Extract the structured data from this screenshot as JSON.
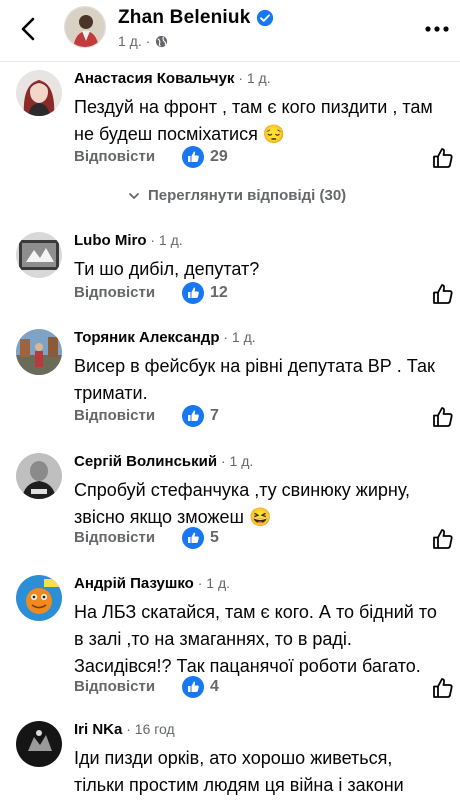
{
  "header": {
    "name": "Zhan  Beleniuk",
    "meta": "1 д. ·"
  },
  "comments": [
    {
      "author": "Анастасия Ковальчук",
      "time": " · 1 д.",
      "text": "Пездуй на фронт , там є кого пиздити , там не будеш посміхатися 😔",
      "reply_label": "Відповісти",
      "likes": "29"
    },
    {
      "author": "Lubo Miro",
      "time": " · 1 д.",
      "text": "Ти шо дибіл, депутат?",
      "reply_label": "Відповісти",
      "likes": "12"
    },
    {
      "author": "Торяник Александр",
      "time": " · 1 д.",
      "text": "Висер в фейсбук на рівні  депутата ВР . Так тримати.",
      "reply_label": "Відповісти",
      "likes": "7"
    },
    {
      "author": "Сергій Волинський",
      "time": " · 1 д.",
      "text": "Спробуй стефанчука ,ту свинюку жирну, звісно якщо зможеш 😆",
      "reply_label": "Відповісти",
      "likes": "5"
    },
    {
      "author": "Андрій Пазушко",
      "time": " · 1 д.",
      "text": "На ЛБЗ скатайся, там є кого. А то бідний то в залі ,то на змаганнях, то в раді. Засидівся!?  Так пацанячої роботи багато.",
      "reply_label": "Відповісти",
      "likes": "4"
    },
    {
      "author": "Iri  NKa",
      "time": " · 16 год",
      "text": "Іди пизди орків, ато хорошо живеться, тільки простим людям ця війна і закони",
      "reply_label": "",
      "likes": ""
    }
  ],
  "view_replies": "Переглянути відповіді (30)",
  "colors": {
    "like_blue": "#1877f2",
    "secondary_text": "#65676b"
  }
}
